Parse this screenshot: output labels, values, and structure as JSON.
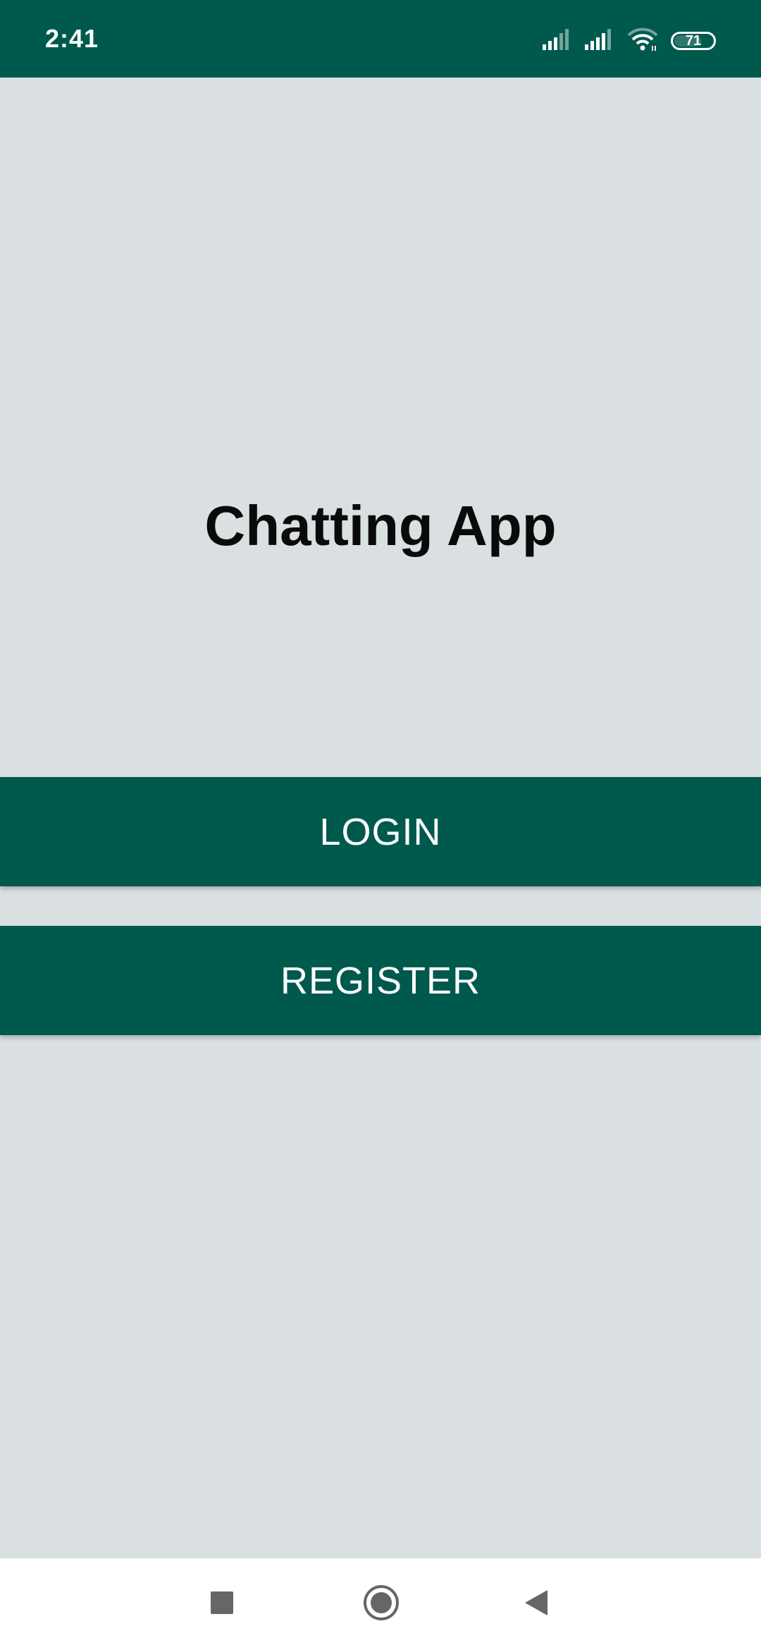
{
  "status_bar": {
    "time": "2:41",
    "battery_level": "71",
    "battery_fraction": 0.71,
    "icons": [
      "cell-signal-icon",
      "cell-signal-icon",
      "wifi-icon",
      "battery-icon"
    ],
    "background": "#00594d"
  },
  "main": {
    "title": "Chatting App",
    "background": "#dadfe1"
  },
  "buttons": {
    "login_label": "LOGIN",
    "register_label": "REGISTER",
    "color": "#00594d"
  },
  "nav_bar": {
    "icons": [
      "recents-square-icon",
      "home-circle-icon",
      "back-triangle-icon"
    ]
  }
}
